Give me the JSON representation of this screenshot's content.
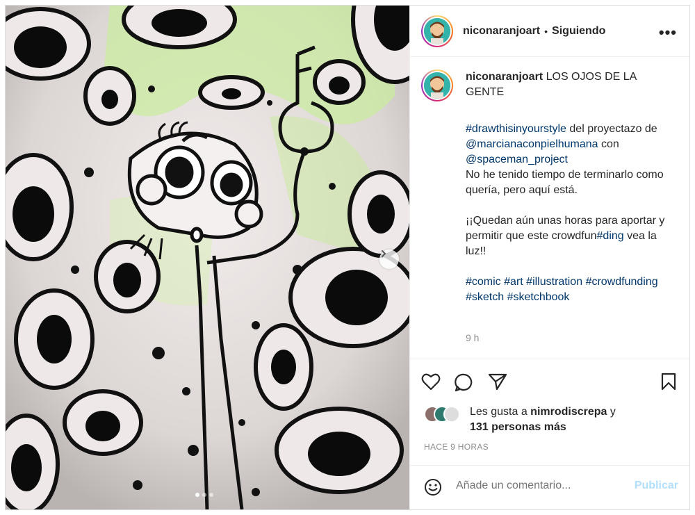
{
  "post": {
    "username": "niconaranjoart",
    "separator": "•",
    "follow_state": "Siguiendo",
    "more_label": "•••",
    "caption_title": "LOS OJOS DE LA GENTE",
    "caption_lines": [
      {
        "parts": [
          {
            "t": "#drawthisinyourstyle",
            "tag": true
          },
          {
            "t": " del proyectazo de ",
            "tag": false
          },
          {
            "t": "@marcianaconpielhumana",
            "tag": true
          },
          {
            "t": " con ",
            "tag": false
          },
          {
            "t": "@spaceman_project",
            "tag": true
          }
        ]
      },
      {
        "parts": [
          {
            "t": "No he tenido tiempo de terminarlo como quería, pero aquí está.",
            "tag": false
          }
        ]
      },
      {
        "parts": [
          {
            "t": "¡¡Quedan aún unas horas para aportar y permitir que este crowdfun",
            "tag": false
          },
          {
            "t": "#ding",
            "tag": true
          },
          {
            "t": " vea la luz!!",
            "tag": false
          }
        ]
      },
      {
        "parts": [
          {
            "t": "#comic",
            "tag": true
          },
          {
            "t": " ",
            "tag": false
          },
          {
            "t": "#art",
            "tag": true
          },
          {
            "t": " ",
            "tag": false
          },
          {
            "t": "#illustration",
            "tag": true
          },
          {
            "t": " ",
            "tag": false
          },
          {
            "t": "#crowdfunding",
            "tag": true
          },
          {
            "t": " ",
            "tag": false
          },
          {
            "t": "#sketch",
            "tag": true
          },
          {
            "t": " ",
            "tag": false
          },
          {
            "t": "#sketchbook",
            "tag": true
          }
        ]
      }
    ],
    "caption_time": "9 h",
    "likes_prefix": "Les gusta a ",
    "likes_user": "nimrodiscrepa",
    "likes_mid": " y",
    "likes_others": "131 personas más",
    "posted_ago": "HACE 9 HORAS",
    "comment_placeholder": "Añade un comentario...",
    "publish_label": "Publicar",
    "carousel_total": 3,
    "carousel_index": 1
  },
  "colors": {
    "hashtag": "#00376b",
    "publish_disabled": "#b2dffc",
    "muted": "#8e8e8e",
    "art_green": "#b7e08a"
  },
  "icons": [
    "heart-icon",
    "comment-icon",
    "share-icon",
    "bookmark-icon",
    "emoji-icon",
    "chevron-right-icon",
    "more-icon"
  ]
}
